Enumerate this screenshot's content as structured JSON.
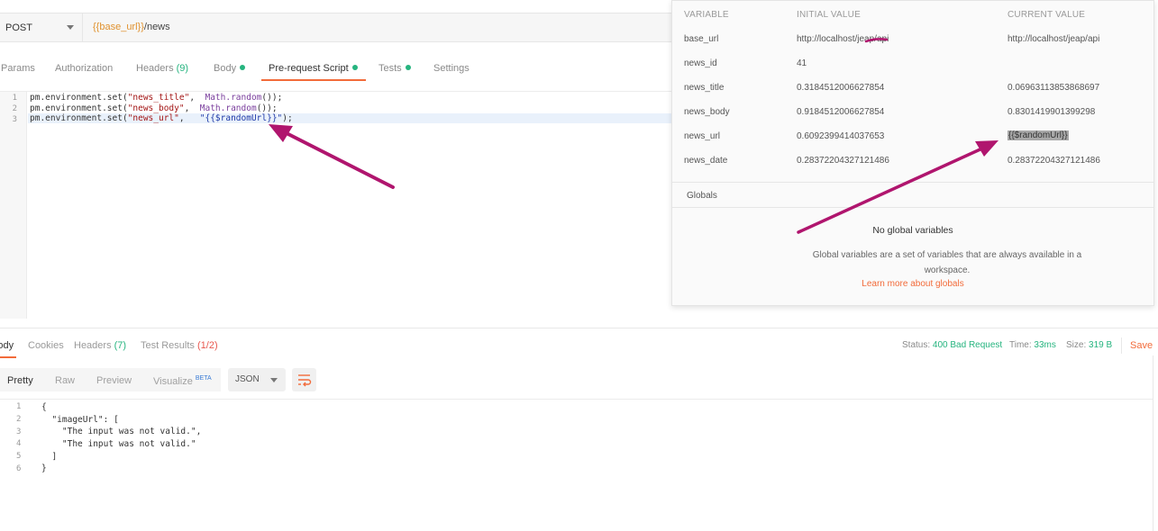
{
  "request": {
    "method": "POST",
    "url_var": "{{base_url}}",
    "url_path": "/news"
  },
  "request_tabs": [
    {
      "label": "Params",
      "count": "",
      "dot": false
    },
    {
      "label": "Authorization",
      "count": "",
      "dot": false
    },
    {
      "label": "Headers",
      "count": "(9)",
      "dot": false
    },
    {
      "label": "Body",
      "count": "",
      "dot": true
    },
    {
      "label": "Pre-request Script",
      "count": "",
      "dot": true
    },
    {
      "label": "Tests",
      "count": "",
      "dot": true
    },
    {
      "label": "Settings",
      "count": "",
      "dot": false
    }
  ],
  "active_request_tab": "Pre-request Script",
  "script": {
    "line_numbers": [
      "1",
      "2",
      "3"
    ],
    "lines": [
      {
        "pre": "pm.environment.set(",
        "str": "\"news_title\"",
        "mid": ",  ",
        "fn": "Math.random",
        "post": "());"
      },
      {
        "pre": "pm.environment.set(",
        "str": "\"news_body\"",
        "mid": ",  ",
        "fn": "Math.random",
        "post": "());"
      },
      {
        "pre": "pm.environment.set(",
        "str": "\"news_url\"",
        "mid": ",   ",
        "value": "\"{{$randomUrl}}\"",
        "post": ");"
      }
    ]
  },
  "response_tabs": [
    {
      "label": "Body",
      "count": ""
    },
    {
      "label": "Cookies",
      "count": ""
    },
    {
      "label": "Headers",
      "count": "(7)"
    },
    {
      "label": "Test Results",
      "count": "(1/2)"
    }
  ],
  "response_status": {
    "status_label": "Status:",
    "status_value": "400 Bad Request",
    "time_label": "Time:",
    "time_value": "33ms",
    "size_label": "Size:",
    "size_value": "319 B",
    "save_label": "Save"
  },
  "view_modes": [
    "Pretty",
    "Raw",
    "Preview",
    "Visualize"
  ],
  "visualize_badge": "BETA",
  "format": "JSON",
  "response_body": {
    "line_numbers": [
      "1",
      "2",
      "3",
      "4",
      "5",
      "6"
    ],
    "lines": [
      "{",
      "  \"imageUrl\": [",
      "    \"The input was not valid.\",",
      "    \"The input was not valid.\"",
      "  ]",
      "}"
    ]
  },
  "environment": {
    "headers": {
      "variable": "VARIABLE",
      "initial": "INITIAL VALUE",
      "current": "CURRENT VALUE"
    },
    "rows": [
      {
        "name": "base_url",
        "initial": "http://localhost/jeap/api",
        "current": "http://localhost/jeap/api"
      },
      {
        "name": "news_id",
        "initial": "41",
        "current": ""
      },
      {
        "name": "news_title",
        "initial": "0.3184512006627854",
        "current": "0.06963113853868697"
      },
      {
        "name": "news_body",
        "initial": "0.9184512006627854",
        "current": "0.8301419901399298"
      },
      {
        "name": "news_url",
        "initial": "0.6092399414037653",
        "current": "{{$randomUrl}}"
      },
      {
        "name": "news_date",
        "initial": "0.28372204327121486",
        "current": "0.28372204327121486"
      }
    ],
    "globals_label": "Globals",
    "no_globals_title": "No global variables",
    "globals_description": "Global variables are a set of variables that are always available in a workspace.",
    "globals_link": "Learn more about globals"
  },
  "colors": {
    "accent": "#f26b3a",
    "success": "#26b47f",
    "error": "#e8584f",
    "annotation_arrow": "#b0156e"
  }
}
